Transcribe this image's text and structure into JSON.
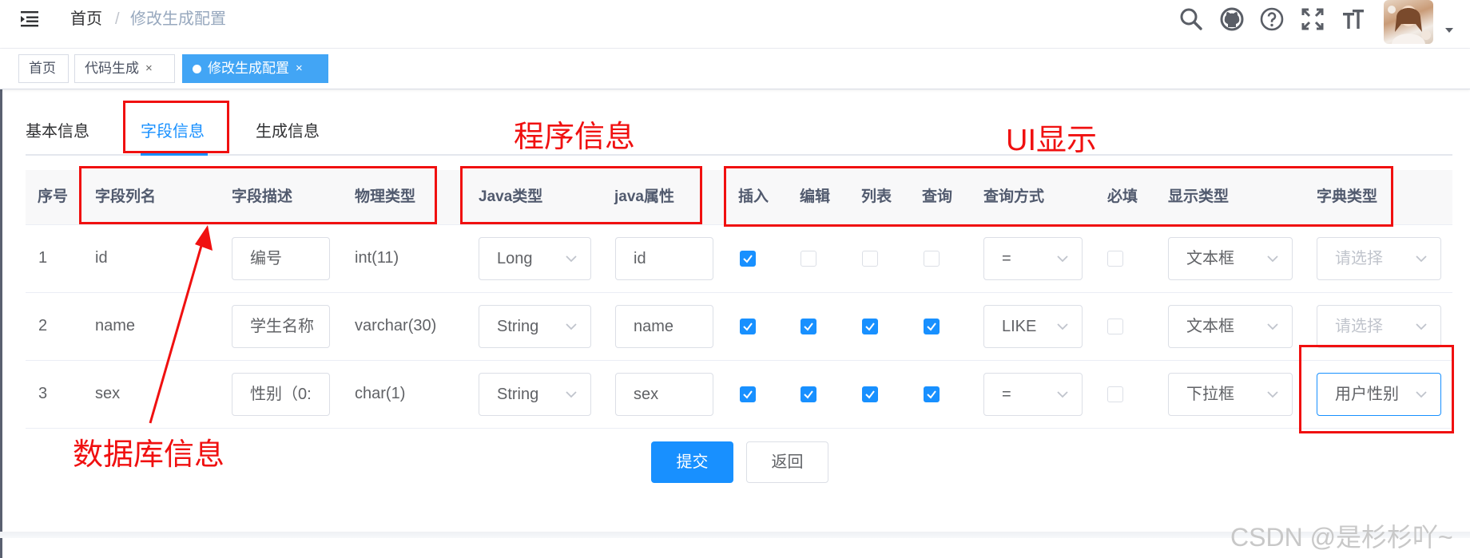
{
  "navbar": {
    "breadcrumb": [
      "首页",
      "/",
      "修改生成配置"
    ],
    "icons": [
      "search-icon",
      "github-icon",
      "question-icon",
      "fullscreen-icon",
      "font-size-icon",
      "caret-down-icon"
    ]
  },
  "tags": [
    {
      "label": "首页",
      "active": false
    },
    {
      "label": "代码生成",
      "active": false,
      "close": "×"
    },
    {
      "label": "修改生成配置",
      "active": true,
      "close": "×"
    }
  ],
  "tabs": [
    "基本信息",
    "字段信息",
    "生成信息"
  ],
  "table": {
    "headers": [
      "序号",
      "字段列名",
      "字段描述",
      "物理类型",
      "Java类型",
      "java属性",
      "插入",
      "编辑",
      "列表",
      "查询",
      "查询方式",
      "必填",
      "显示类型",
      "字典类型"
    ],
    "rows": [
      {
        "index": "1",
        "column": "id",
        "comment": "编号",
        "physical": "int(11)",
        "java_type": "Long",
        "java_field": "id",
        "insert": true,
        "edit": false,
        "list": false,
        "query": false,
        "query_type": "=",
        "required": false,
        "html_type": "文本框",
        "dict_type": "请选择",
        "dict_placeholder": true
      },
      {
        "index": "2",
        "column": "name",
        "comment": "学生名称",
        "physical": "varchar(30)",
        "java_type": "String",
        "java_field": "name",
        "insert": true,
        "edit": true,
        "list": true,
        "query": true,
        "query_type": "LIKE",
        "required": false,
        "html_type": "文本框",
        "dict_type": "请选择",
        "dict_placeholder": true
      },
      {
        "index": "3",
        "column": "sex",
        "comment": "性别（0:",
        "physical": "char(1)",
        "java_type": "String",
        "java_field": "sex",
        "insert": true,
        "edit": true,
        "list": true,
        "query": true,
        "query_type": "=",
        "required": false,
        "html_type": "下拉框",
        "dict_type": "用户性别",
        "dict_placeholder": false
      }
    ]
  },
  "buttons": {
    "submit": "提交",
    "back": "返回"
  },
  "annotations": {
    "program_info": "程序信息",
    "ui_display": "UI显示",
    "db_info": "数据库信息"
  },
  "watermark": "CSDN @是杉杉吖~",
  "colors": {
    "primary": "#1890ff",
    "tag_active": "#42a5f5",
    "annotation": "#f01010"
  }
}
